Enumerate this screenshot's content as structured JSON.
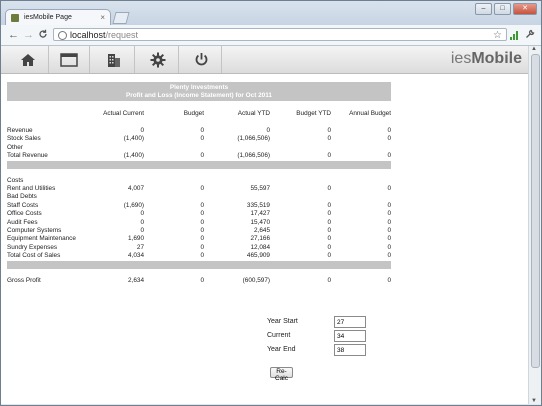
{
  "browser": {
    "tab_title": "iesMobile Page",
    "tab_close": "×",
    "new_tab": "+",
    "url_host": "localhost",
    "url_path": "/request",
    "back": "←",
    "forward": "→",
    "reload": "C",
    "star": "☆",
    "wrench": "🔧",
    "minimize": "–",
    "restore": "□",
    "close": "✕"
  },
  "app": {
    "brand_prefix": "ies",
    "brand_suffix": "Mobile",
    "nav": [
      "home-icon",
      "window-icon",
      "building-icon",
      "gear-icon",
      "power-icon"
    ]
  },
  "report": {
    "company": "Plenty Investments",
    "title": "Profit and Loss (Income Statement) for Oct 2011",
    "columns": [
      "",
      "Actual Current",
      "Budget",
      "Actual YTD",
      "Budget YTD",
      "Annual Budget"
    ],
    "sections": [
      {
        "rows": [
          [
            "Revenue",
            "0",
            "0",
            "0",
            "0",
            "0"
          ],
          [
            "Stock Sales",
            "(1,400)",
            "0",
            "(1,066,506)",
            "0",
            "0"
          ],
          [
            "Other",
            "",
            "",
            "",
            "",
            ""
          ],
          [
            "Total Revenue",
            "(1,400)",
            "0",
            "(1,066,506)",
            "0",
            "0"
          ]
        ]
      },
      {
        "rows": [
          [
            "Costs",
            "",
            "",
            "",
            "",
            ""
          ],
          [
            "Rent and Utilities",
            "4,007",
            "0",
            "55,597",
            "0",
            "0"
          ],
          [
            "Bad Debts",
            "",
            "",
            "",
            "",
            ""
          ],
          [
            "Staff Costs",
            "(1,690)",
            "0",
            "335,519",
            "0",
            "0"
          ],
          [
            "Office Costs",
            "0",
            "0",
            "17,427",
            "0",
            "0"
          ],
          [
            "Audit Fees",
            "0",
            "0",
            "15,470",
            "0",
            "0"
          ],
          [
            "Computer Systems",
            "0",
            "0",
            "2,645",
            "0",
            "0"
          ],
          [
            "Equipment Maintenance",
            "1,690",
            "0",
            "27,166",
            "0",
            "0"
          ],
          [
            "Sundry Expenses",
            "27",
            "0",
            "12,084",
            "0",
            "0"
          ],
          [
            "Total Cost of Sales",
            "4,034",
            "0",
            "465,909",
            "0",
            "0"
          ]
        ]
      },
      {
        "rows": [
          [
            "Gross Profit",
            "2,634",
            "0",
            "(600,597)",
            "0",
            "0"
          ]
        ]
      }
    ]
  },
  "form": {
    "year_start_label": "Year Start",
    "year_start_value": "27",
    "current_label": "Current",
    "current_value": "34",
    "year_end_label": "Year End",
    "year_end_value": "38",
    "recalc_label": "Re-Calc"
  }
}
